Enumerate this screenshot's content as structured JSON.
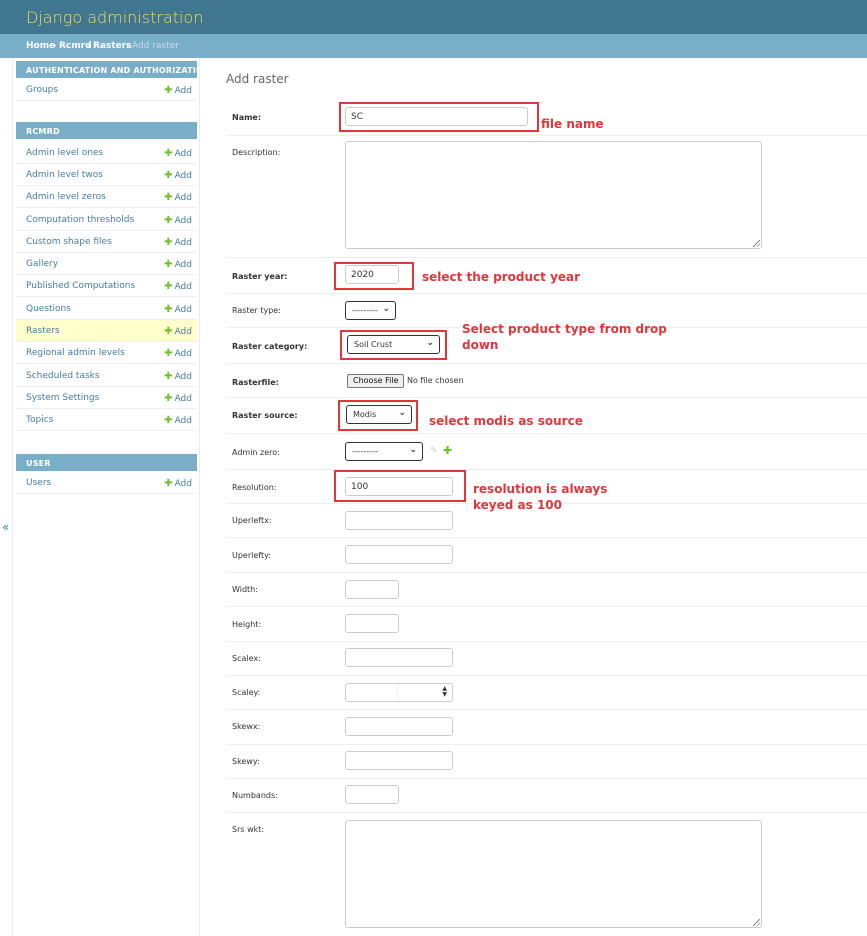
{
  "header": {
    "site_title": "Django administration"
  },
  "breadcrumbs": {
    "home": "Home",
    "app": "Rcmrd",
    "model": "Rasters",
    "current": "Add raster",
    "separator": "›"
  },
  "nav_toggle": {
    "glyph": "«"
  },
  "sidebar": {
    "add_label": "Add",
    "add_icon": "plus-icon",
    "modules": [
      {
        "caption": "AUTHENTICATION AND AUTHORIZATION",
        "models": [
          {
            "name": "Groups"
          }
        ]
      },
      {
        "caption": "RCMRD",
        "models": [
          {
            "name": "Admin level ones"
          },
          {
            "name": "Admin level twos"
          },
          {
            "name": "Admin level zeros"
          },
          {
            "name": "Computation thresholds"
          },
          {
            "name": "Custom shape files"
          },
          {
            "name": "Gallery"
          },
          {
            "name": "Published Computations"
          },
          {
            "name": "Questions"
          },
          {
            "name": "Rasters",
            "current": true
          },
          {
            "name": "Regional admin levels"
          },
          {
            "name": "Scheduled tasks"
          },
          {
            "name": "System Settings"
          },
          {
            "name": "Topics"
          }
        ]
      },
      {
        "caption": "USER",
        "models": [
          {
            "name": "Users"
          }
        ]
      }
    ]
  },
  "form": {
    "title": "Add raster",
    "fields": {
      "name": {
        "label": "Name:",
        "value": "SC"
      },
      "description": {
        "label": "Description:"
      },
      "raster_year": {
        "label": "Raster year:",
        "value": "2020"
      },
      "raster_type": {
        "label": "Raster type:",
        "selected": "---------"
      },
      "raster_category": {
        "label": "Raster category:",
        "selected": "Soil Crust"
      },
      "rasterfile": {
        "label": "Rasterfile:",
        "button": "Choose File",
        "status": "No file chosen"
      },
      "raster_source": {
        "label": "Raster source:",
        "selected": "Modis"
      },
      "admin_zero": {
        "label": "Admin zero:",
        "selected": "---------"
      },
      "resolution": {
        "label": "Resolution:",
        "value": "100"
      },
      "uperleftx": {
        "label": "Uperleftx:",
        "value": ""
      },
      "uperlefty": {
        "label": "Uperlefty:",
        "value": ""
      },
      "width": {
        "label": "Width:",
        "value": ""
      },
      "height": {
        "label": "Height:",
        "value": ""
      },
      "scalex": {
        "label": "Scalex:",
        "value": ""
      },
      "scaley": {
        "label": "Scaley:",
        "value": ""
      },
      "skewx": {
        "label": "Skewx:",
        "value": ""
      },
      "skewy": {
        "label": "Skewy:",
        "value": ""
      },
      "numbands": {
        "label": "Numbands:",
        "value": ""
      },
      "srs_wkt": {
        "label": "Srs wkt:"
      }
    }
  },
  "annotations": {
    "file_name": "file name",
    "product_year": "select the product year",
    "product_type_line1": "Select product type from drop",
    "product_type_line2": "down",
    "source": "select modis as source",
    "resolution_line1": "resolution is always",
    "resolution_line2": "keyed as 100",
    "color": "#e0373b"
  },
  "colors": {
    "header_bg": "#417690",
    "title_yellow": "#f5dd5d",
    "breadcrumb_bg": "#79aec8",
    "link_blue": "#447e9b",
    "add_green": "#70bf2b",
    "current_row": "#ffffcc"
  }
}
